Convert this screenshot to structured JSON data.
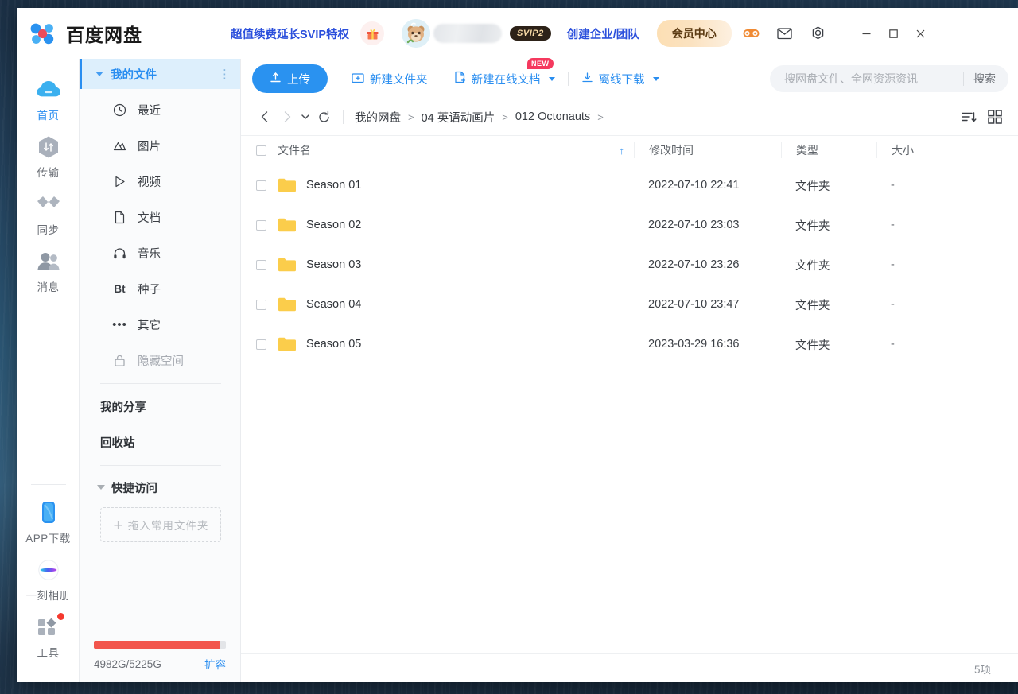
{
  "window": {
    "brand_name": "百度网盘",
    "promo_link": "超值续费延长SVIP特权",
    "gift_icon": "gift-icon",
    "svip_badge": "SVIP2",
    "team_link": "创建企业/团队",
    "vip_button": "会员中心",
    "game_icon": "gamepad-icon",
    "mail_icon": "mail-icon",
    "settings_icon": "gear-icon",
    "minimize": "—",
    "maximize": "▢",
    "close": "✕"
  },
  "rail": {
    "items": [
      {
        "label": "首页",
        "icon": "cloud-icon",
        "active": true
      },
      {
        "label": "传输",
        "icon": "transfer-icon",
        "active": false
      },
      {
        "label": "同步",
        "icon": "sync-icon",
        "active": false
      },
      {
        "label": "消息",
        "icon": "message-icon",
        "active": false
      }
    ],
    "bottom_items": [
      {
        "label": "APP下载",
        "icon": "phone-icon"
      },
      {
        "label": "一刻相册",
        "icon": "album-icon"
      },
      {
        "label": "工具",
        "icon": "tools-icon",
        "badge": true
      }
    ]
  },
  "tree": {
    "header": {
      "label": "我的文件",
      "menu_icon": "more-vertical-icon"
    },
    "items": [
      {
        "label": "最近",
        "icon": "clock-icon",
        "muted": false
      },
      {
        "label": "图片",
        "icon": "image-icon",
        "muted": false
      },
      {
        "label": "视频",
        "icon": "video-icon",
        "muted": false
      },
      {
        "label": "文档",
        "icon": "document-icon",
        "muted": false
      },
      {
        "label": "音乐",
        "icon": "music-icon",
        "muted": false
      },
      {
        "label": "种子",
        "icon": "bt-icon",
        "muted": false
      },
      {
        "label": "其它",
        "icon": "ellipsis-icon",
        "muted": false
      },
      {
        "label": "隐藏空间",
        "icon": "lock-icon",
        "muted": true
      }
    ],
    "links": [
      {
        "label": "我的分享"
      },
      {
        "label": "回收站"
      }
    ],
    "quick_access": {
      "label": "快捷访问",
      "dropzone": "＋ 拖入常用文件夹"
    },
    "storage": {
      "used_text": "4982G/5225G",
      "expand_link": "扩容",
      "percent": 95,
      "bar_color": "#f2564d"
    }
  },
  "toolbar": {
    "upload_label": "上传",
    "upload_icon": "upload-icon",
    "new_folder_label": "新建文件夹",
    "new_folder_icon": "folder-plus-icon",
    "new_doc_label": "新建在线文档",
    "new_doc_icon": "file-plus-icon",
    "new_doc_tag": "NEW",
    "offline_dl_label": "离线下载",
    "offline_dl_icon": "download-icon"
  },
  "search": {
    "placeholder": "搜网盘文件、全网资源资讯",
    "value": "",
    "button_label": "搜索"
  },
  "breadcrumb": {
    "back_icon": "chevron-left-icon",
    "forward_icon": "chevron-right-icon",
    "history_icon": "chevron-down-icon",
    "refresh_icon": "refresh-icon",
    "parts": [
      "我的网盘",
      "04 英语动画片",
      "012 Octonauts"
    ],
    "trailing_arrow": ">",
    "separator": ">"
  },
  "view_tools": {
    "sort_icon": "sort-descending-icon",
    "grid_icon": "grid-view-icon"
  },
  "table": {
    "columns": [
      "文件名",
      "修改时间",
      "类型",
      "大小"
    ],
    "sort_indicator": "↑",
    "rows": [
      {
        "name": "Season 01",
        "modified": "2022-07-10 22:41",
        "type": "文件夹",
        "size": "-",
        "icon": "folder-icon"
      },
      {
        "name": "Season 02",
        "modified": "2022-07-10 23:03",
        "type": "文件夹",
        "size": "-",
        "icon": "folder-icon"
      },
      {
        "name": "Season 03",
        "modified": "2022-07-10 23:26",
        "type": "文件夹",
        "size": "-",
        "icon": "folder-icon"
      },
      {
        "name": "Season 04",
        "modified": "2022-07-10 23:47",
        "type": "文件夹",
        "size": "-",
        "icon": "folder-icon"
      },
      {
        "name": "Season 05",
        "modified": "2023-03-29 16:36",
        "type": "文件夹",
        "size": "-",
        "icon": "folder-icon"
      }
    ]
  },
  "status": {
    "item_count": "5项"
  },
  "colors": {
    "accent": "#2a8ef0",
    "link": "#2b4fdc",
    "folder": "#fbcd4b",
    "storage": "#f2564d",
    "badge": "#f5395e"
  }
}
